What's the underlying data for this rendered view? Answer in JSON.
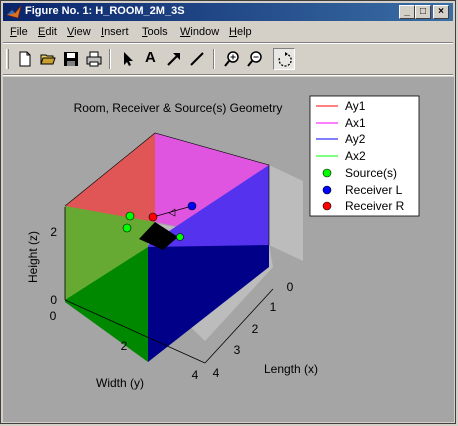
{
  "window": {
    "title": "Figure No. 1: H_ROOM_2M_3S"
  },
  "title_buttons": {
    "minimize": "_",
    "maximize": "□",
    "close": "×"
  },
  "menu": [
    {
      "label": "File",
      "accel": "F",
      "rest": "ile"
    },
    {
      "label": "Edit",
      "accel": "E",
      "rest": "dit"
    },
    {
      "label": "View",
      "accel": "V",
      "rest": "iew"
    },
    {
      "label": "Insert",
      "accel": "I",
      "rest": "nsert"
    },
    {
      "label": "Tools",
      "accel": "T",
      "rest": "ools"
    },
    {
      "label": "Window",
      "accel": "W",
      "rest": "indow"
    },
    {
      "label": "Help",
      "accel": "H",
      "rest": "elp"
    }
  ],
  "toolbar": {
    "buttons": [
      "new-icon",
      "open-icon",
      "save-icon",
      "print-icon",
      "select-arrow-icon",
      "text-icon",
      "arrow-icon",
      "line-icon",
      "zoom-in-icon",
      "zoom-out-icon",
      "rotate-icon"
    ],
    "text_tool_label": "A",
    "pressed": "rotate-icon"
  },
  "plot": {
    "title": "Room, Receiver & Source(s) Geometry",
    "xlabel": "Length (x)",
    "ylabel": "Width (y)",
    "zlabel": "Height (z)",
    "x_ticks": [
      "0",
      "1",
      "2",
      "3",
      "4"
    ],
    "y_ticks": [
      "0",
      "2",
      "4"
    ],
    "z_ticks": [
      "0",
      "2"
    ],
    "legend": [
      {
        "label": "Ay1",
        "kind": "line",
        "color": "#ff0000"
      },
      {
        "label": "Ax1",
        "kind": "line",
        "color": "#ff00ff"
      },
      {
        "label": "Ay2",
        "kind": "line",
        "color": "#0000ff"
      },
      {
        "label": "Ax2",
        "kind": "line",
        "color": "#00ff00"
      },
      {
        "label": "Source(s)",
        "kind": "marker",
        "color": "#00ff00"
      },
      {
        "label": "Receiver L",
        "kind": "marker",
        "color": "#0000ff"
      },
      {
        "label": "Receiver R",
        "kind": "marker",
        "color": "#ff0000"
      }
    ],
    "colors": {
      "background": "#a5a5a5",
      "wall_ay1": "#e05555",
      "wall_ax1": "#e055e0",
      "wall_ay2": "#4422dd",
      "wall_ax2": "#66aa33",
      "floor_front": "#008800",
      "floor_right": "#000088",
      "floor_center": "#000000"
    }
  }
}
